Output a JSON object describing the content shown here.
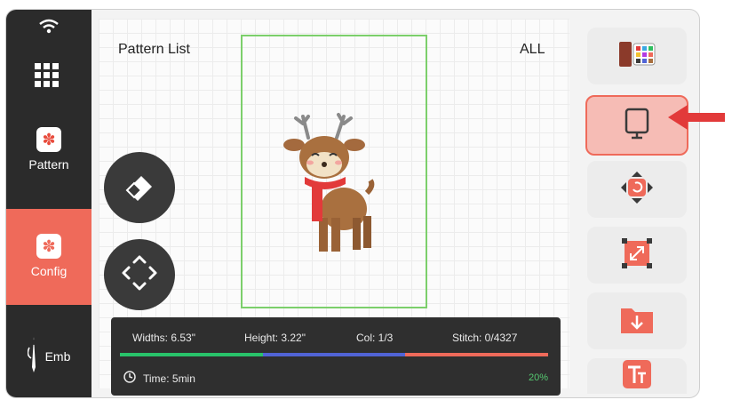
{
  "nav": {
    "pattern_label": "Pattern",
    "config_label": "Config",
    "emb_label": "Emb"
  },
  "canvas": {
    "title": "Pattern List",
    "filter": "ALL"
  },
  "info": {
    "widths": "Widths: 6.53\"",
    "height": "Height: 3.22\"",
    "col": "Col: 1/3",
    "stitch": "Stitch: 0/4327",
    "time": "Time: 5min",
    "percent": "20%",
    "progress": 0.2,
    "colors": [
      "#28c36a",
      "#5164d6",
      "#ef6a5a"
    ]
  },
  "icons": {
    "wifi": "wifi-icon",
    "apps": "grid-icon",
    "pattern": "pattern-icon",
    "config": "config-icon",
    "emb": "needle-icon",
    "eraser": "eraser-icon",
    "move": "move-icon",
    "thread": "thread-palette-icon",
    "frame": "frame-trace-icon",
    "rotate": "rotate-icon",
    "resize": "resize-icon",
    "folder": "folder-download-icon",
    "text": "text-edit-icon"
  },
  "colors": {
    "accent": "#ef6a5a",
    "nav_bg": "#2b2b2b",
    "frame_border": "#7ccf6b"
  }
}
